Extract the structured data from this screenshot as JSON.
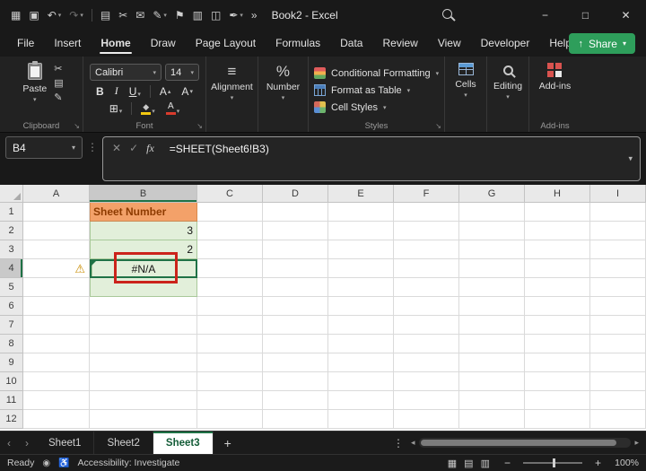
{
  "window": {
    "title": "Book2 - Excel"
  },
  "glyphs": {
    "dropdown": "▾",
    "minimize": "−",
    "maximize": "□",
    "close": "✕",
    "cancel": "✕",
    "check": "✓",
    "dots_v": "⋮",
    "warning": "⚠",
    "borders": "⊞",
    "align": "≡",
    "percent": "%",
    "launcher": "↘",
    "back": "‹",
    "forward": "›",
    "tri_left": "◂",
    "tri_right": "▸",
    "plus": "+",
    "minus": "−",
    "record": "◉",
    "accessibility": "♿",
    "share_arrow": "↑"
  },
  "titlebar": {
    "qat": [
      {
        "name": "app-launcher",
        "glyph": "▦"
      },
      {
        "name": "save",
        "glyph": "▣"
      },
      {
        "name": "undo",
        "glyph": "↶",
        "chev": true
      },
      {
        "name": "redo",
        "glyph": "↷",
        "chev": true,
        "dim": true
      },
      {
        "sep": true
      },
      {
        "name": "copy",
        "glyph": "▤"
      },
      {
        "name": "cut",
        "glyph": "✂"
      },
      {
        "name": "mail",
        "glyph": "✉"
      },
      {
        "name": "pen",
        "glyph": "✎",
        "chev": true
      },
      {
        "name": "flag",
        "glyph": "⚑"
      },
      {
        "name": "document",
        "glyph": "▥"
      },
      {
        "name": "camera",
        "glyph": "◫"
      },
      {
        "name": "ink",
        "glyph": "✒",
        "chev": true
      },
      {
        "name": "overflow",
        "glyph": "»"
      }
    ]
  },
  "menu": {
    "items": [
      {
        "label": "File"
      },
      {
        "label": "Insert"
      },
      {
        "label": "Home",
        "active": true
      },
      {
        "label": "Draw"
      },
      {
        "label": "Page Layout"
      },
      {
        "label": "Formulas"
      },
      {
        "label": "Data"
      },
      {
        "label": "Review"
      },
      {
        "label": "View"
      },
      {
        "label": "Developer"
      },
      {
        "label": "Help"
      }
    ],
    "share_label": "Share"
  },
  "ribbon": {
    "clipboard": {
      "paste_label": "Paste",
      "group_label": "Clipboard"
    },
    "font": {
      "family": "Calibri",
      "size": "14",
      "bold_label": "B",
      "italic_label": "I",
      "underline_label": "U",
      "grow_label": "A",
      "shrink_label": "A",
      "color_label": "A",
      "group_label": "Font"
    },
    "alignment_label": "Alignment",
    "number_label": "Number",
    "styles": {
      "items": [
        "Conditional Formatting",
        "Format as Table",
        "Cell Styles"
      ],
      "group_label": "Styles"
    },
    "cells_label": "Cells",
    "editing_label": "Editing",
    "addins": {
      "button_label": "Add-ins",
      "group_label": "Add-ins"
    }
  },
  "formula_bar": {
    "name_box": "B4",
    "fx_label": "fx",
    "formula": "=SHEET(Sheet6!B3)"
  },
  "grid": {
    "column_headers": [
      "A",
      "B",
      "C",
      "D",
      "E",
      "F",
      "G",
      "H",
      "I"
    ],
    "row_count": 12,
    "selected": {
      "col": "B",
      "row": 4
    },
    "cells": [
      {
        "ref": "B1",
        "text": "Sheet Number",
        "style": "orange",
        "align": "left"
      },
      {
        "ref": "B2",
        "text": "3",
        "style": "green",
        "align": "right"
      },
      {
        "ref": "B3",
        "text": "2",
        "style": "green",
        "align": "right"
      },
      {
        "ref": "B4",
        "text": "#N/A",
        "style": "green",
        "align": "center",
        "selected": true,
        "error_indicator": true,
        "annotation": "red-box"
      },
      {
        "ref": "B5",
        "text": "",
        "style": "green"
      },
      {
        "ref": "A4",
        "icon": "warning"
      }
    ]
  },
  "sheet_tabs": {
    "tabs": [
      {
        "label": "Sheet1"
      },
      {
        "label": "Sheet2"
      },
      {
        "label": "Sheet3",
        "active": true
      }
    ],
    "add_label": "+"
  },
  "status_bar": {
    "mode": "Ready",
    "accessibility": "Accessibility: Investigate",
    "zoom": "100%",
    "views": [
      {
        "name": "normal-view",
        "glyph": "▦"
      },
      {
        "name": "page-layout-view",
        "glyph": "▤"
      },
      {
        "name": "page-break-view",
        "glyph": "▥"
      }
    ]
  },
  "colors": {
    "accent_green": "#217346",
    "selection_green": "#1F7246",
    "share_green": "#2E9E5B",
    "cell_green_fill": "#E2EFDA",
    "cell_orange_fill": "#F3A169",
    "orange_text": "#8E3B00",
    "annotation_red": "#CB231B"
  }
}
